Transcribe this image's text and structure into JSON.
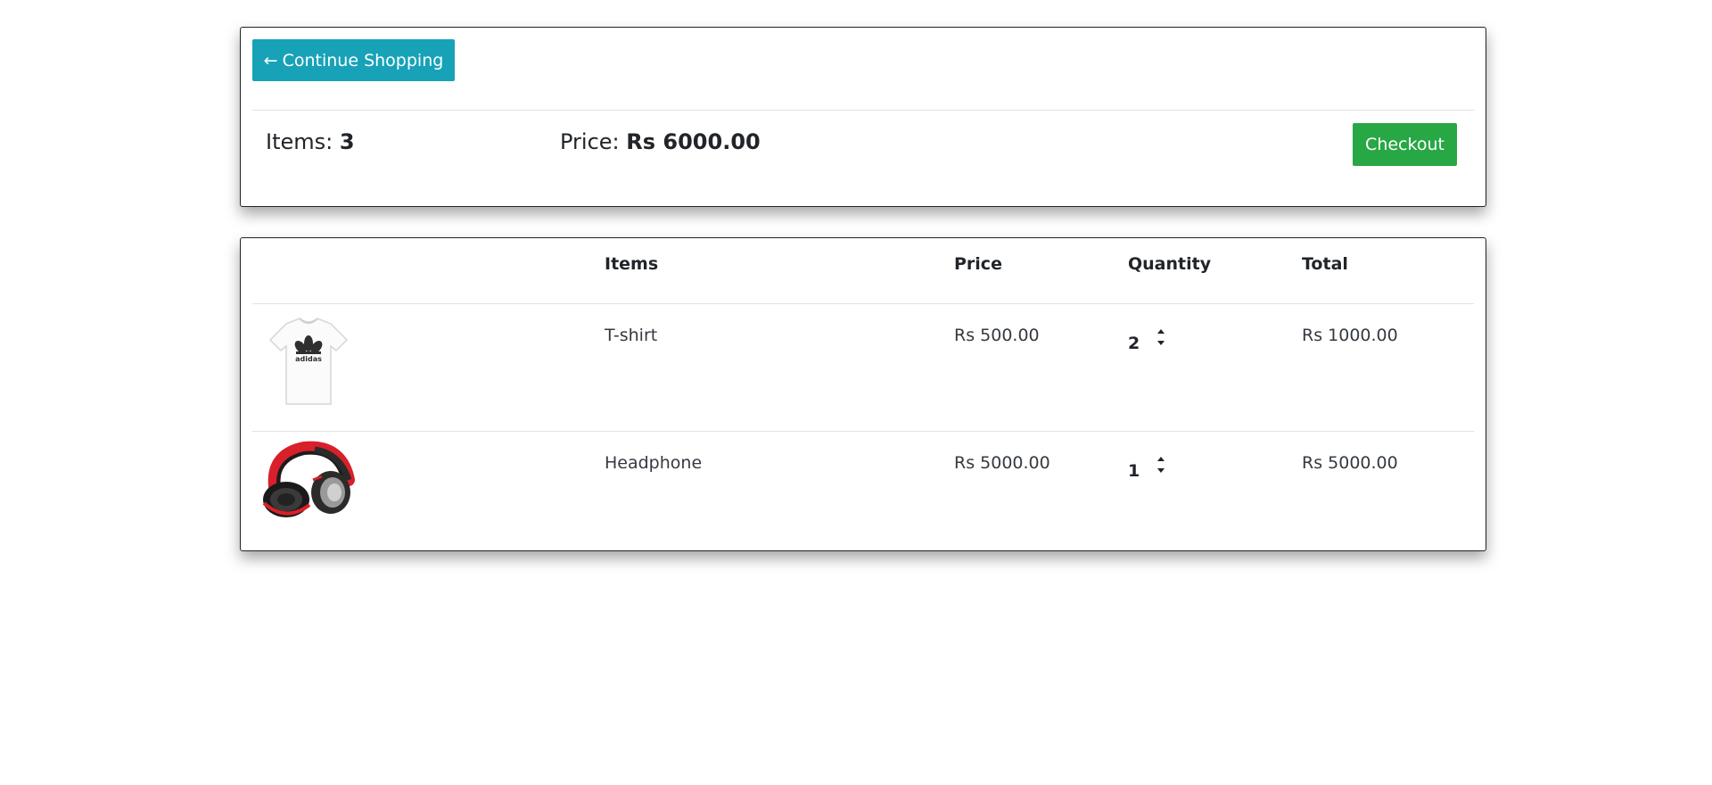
{
  "summary": {
    "continue_label": "Continue Shopping",
    "items_label": "Items:",
    "items_count": "3",
    "price_label": "Price:",
    "price_value": "Rs 6000.00",
    "checkout_label": "Checkout"
  },
  "table": {
    "headers": {
      "items": "Items",
      "price": "Price",
      "quantity": "Quantity",
      "total": "Total"
    },
    "rows": [
      {
        "name": "T-shirt",
        "price": "Rs 500.00",
        "quantity": "2",
        "total": "Rs 1000.00",
        "image": "tshirt-image"
      },
      {
        "name": "Headphone",
        "price": "Rs 5000.00",
        "quantity": "1",
        "total": "Rs 5000.00",
        "image": "headphone-image"
      }
    ]
  },
  "colors": {
    "continue_button": "#17a2b8",
    "checkout_button": "#28a745",
    "card_border": "#212529",
    "divider": "#dee2e6"
  }
}
